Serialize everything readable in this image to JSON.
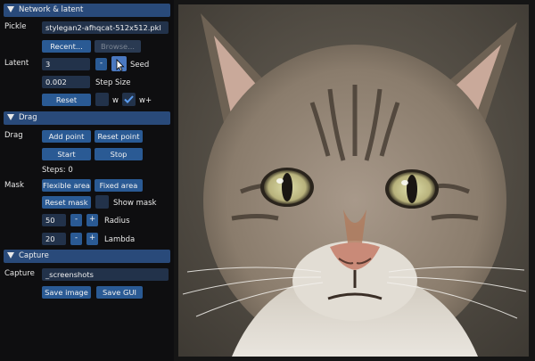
{
  "sections": {
    "network": {
      "title": "Network & latent"
    },
    "drag": {
      "title": "Drag"
    },
    "capture": {
      "title": "Capture"
    }
  },
  "network": {
    "pickle_label": "Pickle",
    "pickle_value": "stylegan2-afhqcat-512x512.pkl",
    "recent_label": "Recent...",
    "browse_label": "Browse...",
    "latent_label": "Latent",
    "seed_value": "3",
    "minus_label": "-",
    "seed_label": "Seed",
    "step_value": "0.002",
    "step_label": "Step Size",
    "reset_label": "Reset",
    "w_label": "w",
    "wplus_label": "w+"
  },
  "drag": {
    "drag_label": "Drag",
    "add_point": "Add point",
    "reset_point": "Reset point",
    "start": "Start",
    "stop": "Stop",
    "steps": "Steps: 0",
    "mask_label": "Mask",
    "flexible_area": "Flexible area",
    "fixed_area": "Fixed area",
    "reset_mask": "Reset mask",
    "show_mask": "Show mask",
    "radius_value": "50",
    "radius_label": "Radius",
    "lambda_value": "20",
    "lambda_label": "Lambda",
    "minus": "-",
    "plus": "+"
  },
  "capture": {
    "capture_label": "Capture",
    "path_value": "_screenshots",
    "save_image": "Save image",
    "save_gui": "Save GUI"
  },
  "colors": {
    "header": "#294a7a",
    "button": "#2a5a94",
    "field": "#22324a",
    "panel": "#0e0e10"
  }
}
